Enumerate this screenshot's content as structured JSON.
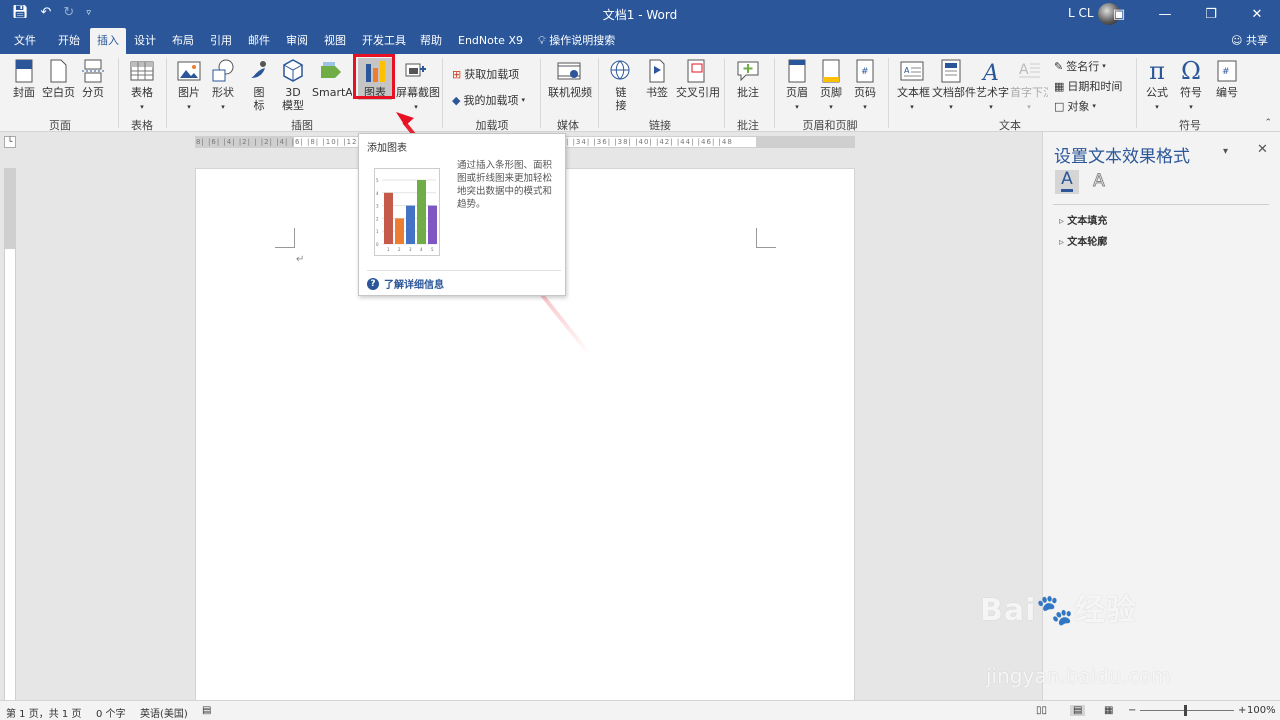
{
  "titlebar": {
    "document": "文档1 - Word",
    "user": "L CL",
    "qat": [
      "save",
      "undo",
      "redo",
      "customize"
    ]
  },
  "tabs": [
    "文件",
    "开始",
    "插入",
    "设计",
    "布局",
    "引用",
    "邮件",
    "审阅",
    "视图",
    "开发工具",
    "帮助",
    "EndNote X9"
  ],
  "active_tab": "插入",
  "search_label": "操作说明搜索",
  "share_label": "共享",
  "ribbon": {
    "cover": "封面",
    "blank": "空白页",
    "pagebreak": "分页",
    "table": "表格",
    "picture": "图片",
    "shape": "形状",
    "icon": "图\n标",
    "model3d": "3D\n模型",
    "smartart": "SmartArt",
    "chart": "图表",
    "screenshot": "屏幕截图",
    "get_addins": "获取加载项",
    "my_addins": "我的加载项",
    "video": "联机视频",
    "link": "链\n接",
    "bookmark": "书签",
    "crossref": "交叉引用",
    "comment": "批注",
    "header": "页眉",
    "footer": "页脚",
    "pagenum": "页码",
    "textbox": "文本框",
    "parts": "文档部件",
    "wordart": "艺术字",
    "dropcap": "首字下沉",
    "sigline": "签名行",
    "datetime": "日期和时间",
    "object": "对象",
    "equation": "公式",
    "symbol": "符号",
    "numbering": "编号"
  },
  "groups": {
    "pages": "页面",
    "tables": "表格",
    "illustrations": "插图",
    "addins": "加载项",
    "media": "媒体",
    "links": "链接",
    "comments": "批注",
    "headerfooter": "页眉和页脚",
    "text": "文本",
    "symbols": "符号"
  },
  "ruler": {
    "h_text": "8| |6| |4| |2| | |2| |4| |6| |8| |10| |12| |14| |16| |18| |20| |22| |24| |26| |28| |30| |32| |34| |36| |38| |40| |42| |44| |46| |48"
  },
  "tooltip": {
    "title": "添加图表",
    "description": "通过插入条形图、面积图或折线图来更加轻松地突出数据中的模式和趋势。",
    "link": "了解详细信息",
    "chart_values": [
      4,
      2,
      3,
      5,
      3
    ],
    "chart_categories": [
      "1",
      "2",
      "3",
      "4",
      "5"
    ],
    "chart_colors": [
      "#c55a4b",
      "#ed7d31",
      "#4472c4",
      "#70ad47",
      "#7e57c2"
    ]
  },
  "pane": {
    "title": "设置文本效果格式",
    "items": [
      "文本填充",
      "文本轮廓"
    ]
  },
  "status": {
    "page": "第 1 页，共 1 页",
    "words": "0 个字",
    "lang": "英语(美国)",
    "zoom": "100%"
  },
  "watermark": {
    "logo": "Bai🐾经验",
    "url": "jingyan.baidu.com"
  },
  "colors": {
    "accent": "#2b579a",
    "highlight": "#e81123"
  }
}
